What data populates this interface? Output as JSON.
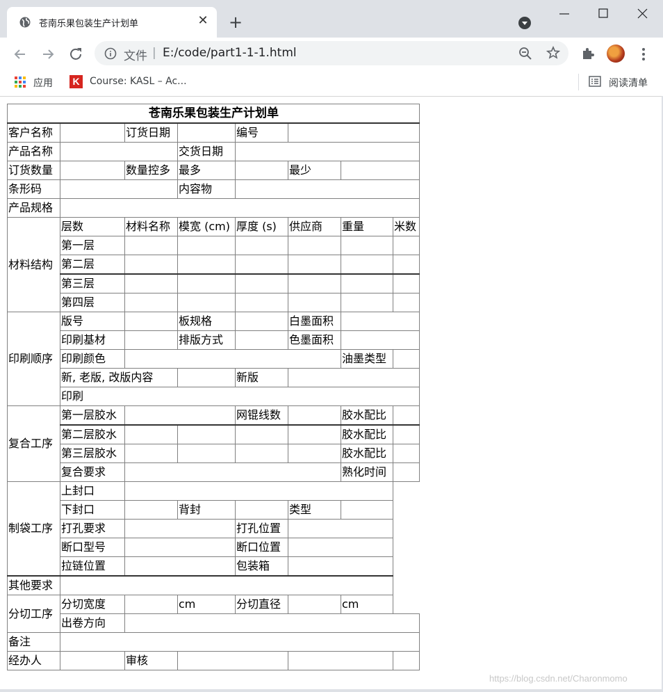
{
  "browser": {
    "tab_title": "苍南乐果包装生产计划单",
    "scheme_label": "文件",
    "separator": "|",
    "url": "E:/code/part1-1-1.html",
    "bookmarks": [
      {
        "label": "应用",
        "icon": "apps-grid-icon"
      },
      {
        "label": "Course: KASL – Ac...",
        "icon": "k-logo-icon"
      }
    ],
    "reading_list_label": "阅读清单"
  },
  "form": {
    "title": "苍南乐果包装生产计划单",
    "customer_name": "客户名称",
    "order_date": "订货日期",
    "number": "编号",
    "product_name": "产品名称",
    "delivery_date": "交货日期",
    "order_qty": "订货数量",
    "qty_control": "数量控多",
    "most": "最多",
    "least": "最少",
    "barcode": "条形码",
    "contents": "内容物",
    "product_spec": "产品规格",
    "material": {
      "section": "材料结构",
      "headers": [
        "层数",
        "材料名称",
        "模宽 (cm)",
        "厚度 (s)",
        "供应商",
        "重量",
        "米数"
      ],
      "layers": [
        "第一层",
        "第二层",
        "第三层",
        "第四层"
      ]
    },
    "printing": {
      "section": "印刷顺序",
      "plate_no": "版号",
      "plate_spec": "板规格",
      "white_ink_area": "白墨面积",
      "substrate": "印刷基材",
      "layout": "排版方式",
      "color_ink_area": "色墨面积",
      "print_color": "印刷颜色",
      "ink_type": "油墨类型",
      "plate_change": "新, 老版, 改版内容",
      "new_plate": "新版",
      "print": "印刷"
    },
    "laminating": {
      "section": "复合工序",
      "glue1": "第一层胶水",
      "mesh_lines": "网锟线数",
      "glue_ratio": "胶水配比",
      "glue2": "第二层胶水",
      "glue3": "第三层胶水",
      "requirements": "复合要求",
      "curing_time": "熟化时间"
    },
    "bagging": {
      "section": "制袋工序",
      "top_seal": "上封口",
      "bottom_seal": "下封口",
      "back_seal": "背封",
      "type": "类型",
      "punch_req": "打孔要求",
      "punch_pos": "打孔位置",
      "notch_model": "断口型号",
      "notch_pos": "断口位置",
      "zipper_pos": "拉链位置",
      "packing_box": "包装箱"
    },
    "other_requirements": "其他要求",
    "slitting": {
      "section": "分切工序",
      "width": "分切宽度",
      "unit1": "cm",
      "diameter": "分切直径",
      "unit2": "cm",
      "direction": "出卷方向"
    },
    "remarks": "备注",
    "handler": "经办人",
    "review": "审核"
  },
  "watermark": "https://blog.csdn.net/Charonmomo"
}
